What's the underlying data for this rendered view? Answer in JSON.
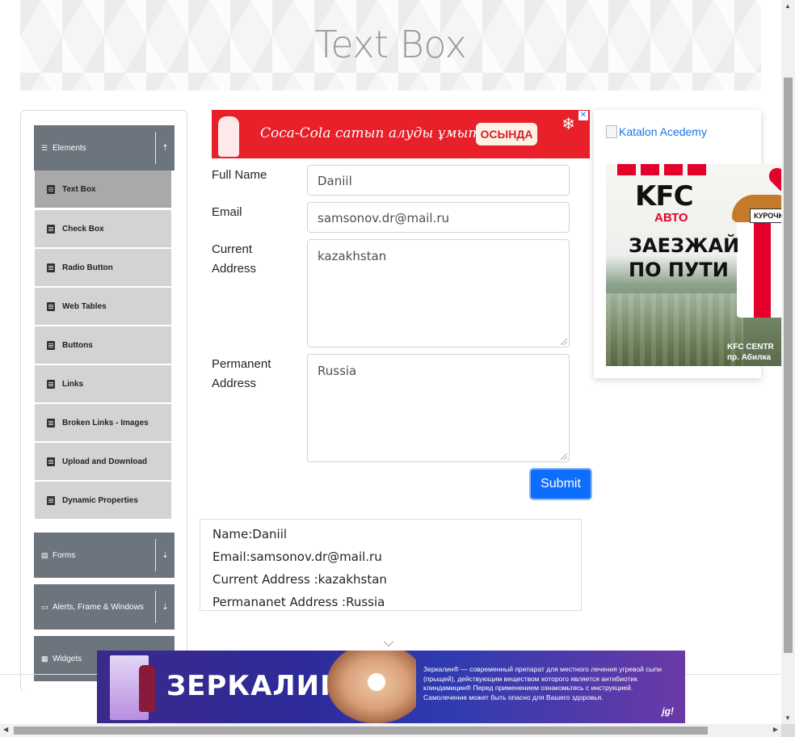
{
  "banner": {
    "title": "Text Box"
  },
  "sidebar": {
    "groups": [
      {
        "label": "Elements",
        "toggle": "⇡"
      },
      {
        "label": "Forms",
        "toggle": "⇣"
      },
      {
        "label": "Alerts, Frame & Windows",
        "toggle": "⇣"
      },
      {
        "label": "Widgets",
        "toggle": ""
      }
    ],
    "items": [
      {
        "label": "Text Box"
      },
      {
        "label": "Check Box"
      },
      {
        "label": "Radio Button"
      },
      {
        "label": "Web Tables"
      },
      {
        "label": "Buttons"
      },
      {
        "label": "Links"
      },
      {
        "label": "Broken Links - Images"
      },
      {
        "label": "Upload and Download"
      },
      {
        "label": "Dynamic Properties"
      }
    ]
  },
  "top_ad": {
    "text": "Coca-Cola сатып алуды ұмытпа",
    "cta": "ОСЫНДА",
    "close": "✕"
  },
  "form": {
    "full_name": {
      "label": "Full Name",
      "value": "Daniil"
    },
    "email": {
      "label": "Email",
      "value": "samsonov.dr@mail.ru"
    },
    "current_address": {
      "label_line1": "Current",
      "label_line2": "Address",
      "value": "kazakhstan"
    },
    "permanent_address": {
      "label_line1": "Permanent",
      "label_line2": "Address",
      "value": "Russia"
    },
    "submit_label": "Submit"
  },
  "output": {
    "name": "Name:Daniil",
    "email": "Email:samsonov.dr@mail.ru",
    "current_address": "Current Address :kazakhstan",
    "permanent_address": "Permananet Address :Russia"
  },
  "right_col": {
    "katalon_link": "Katalon Acedemy",
    "kfc_ad": {
      "logo": "KFC",
      "sub": "АВТО",
      "slogan_line1": "ЗАЕЗЖАЙ",
      "slogan_line2": "ПО ПУТИ",
      "tag": "КУРОЧКИ",
      "centr_line1": "KFC CENTR",
      "centr_line2": "пр. Абилка"
    }
  },
  "bottom_ad": {
    "title": "ЗЕРКАЛИН®",
    "description": "Зеркалин® — современный препарат для местного лечения угревой сыпи (прыщей), действующим веществом которого является антибиотик клиндамицин® Перед применением ознакомьтесь с инструкцией. Самолечение может быть опасно для Вашего здоровья.",
    "badge": "jg!"
  },
  "colors": {
    "sidebar_header": "#6c757d",
    "menu_item": "#d3d3d3",
    "menu_item_active": "#a9a9a9",
    "submit": "#0d6efd",
    "ad_red": "#e8202a"
  }
}
